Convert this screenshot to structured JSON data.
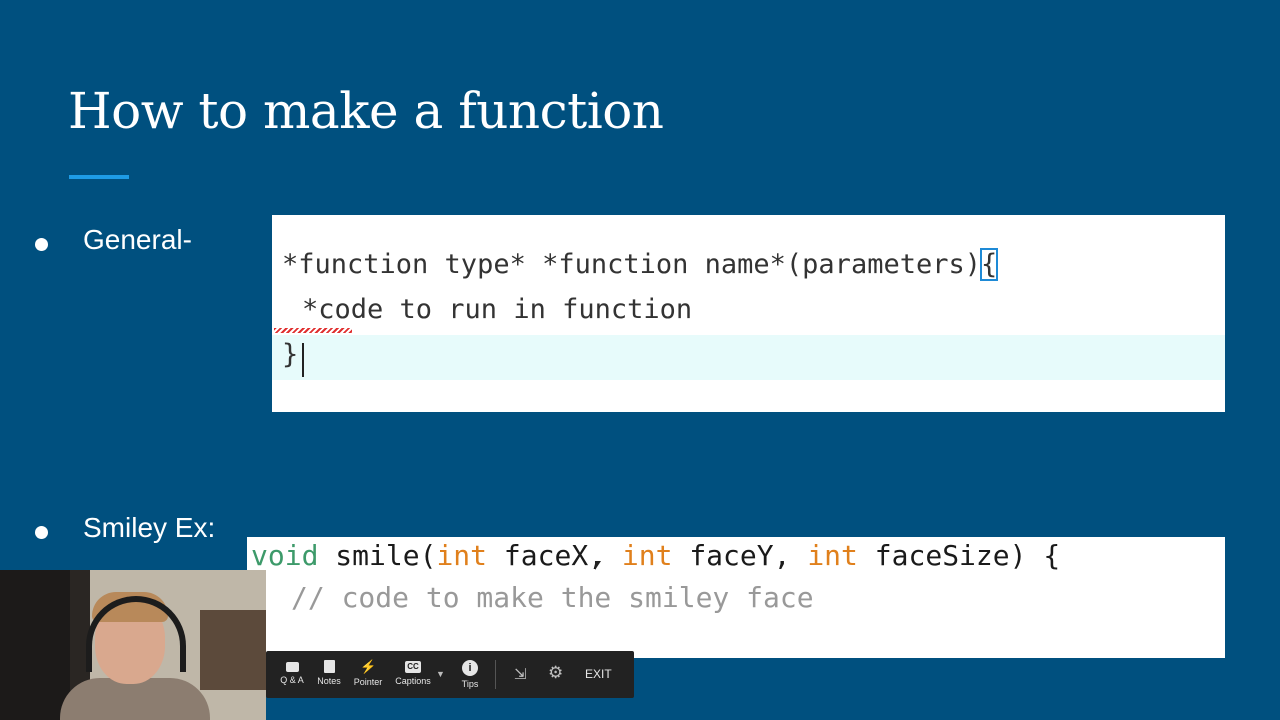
{
  "slide": {
    "title": "How to make a function",
    "bullets": [
      "General-",
      "Smiley Ex:"
    ]
  },
  "code_general": {
    "line1": "*function type* *function name*(parameters)",
    "line1_brace": "{",
    "line2": "*code to run in function",
    "line3": "}"
  },
  "code_smiley": {
    "kw_void": "void",
    "name_open": " smile(",
    "kw_int1": "int",
    "param1": " faceX, ",
    "kw_int2": "int",
    "param2": " faceY, ",
    "kw_int3": "int",
    "param3": " faceSize) {",
    "comment": "// code to make the smiley face"
  },
  "toolbar": {
    "qa": "Q & A",
    "notes": "Notes",
    "pointer": "Pointer",
    "captions": "Captions",
    "tips": "Tips",
    "exit": "EXIT",
    "icons": [
      "qa-icon",
      "notes-icon",
      "pointer-icon",
      "captions-icon",
      "tips-icon",
      "exit-fullscreen-icon",
      "settings-icon"
    ]
  },
  "colors": {
    "background": "#00507f",
    "accent": "#1e9be5",
    "keyword_void": "#3d9a6a",
    "keyword_int": "#e0801c"
  }
}
